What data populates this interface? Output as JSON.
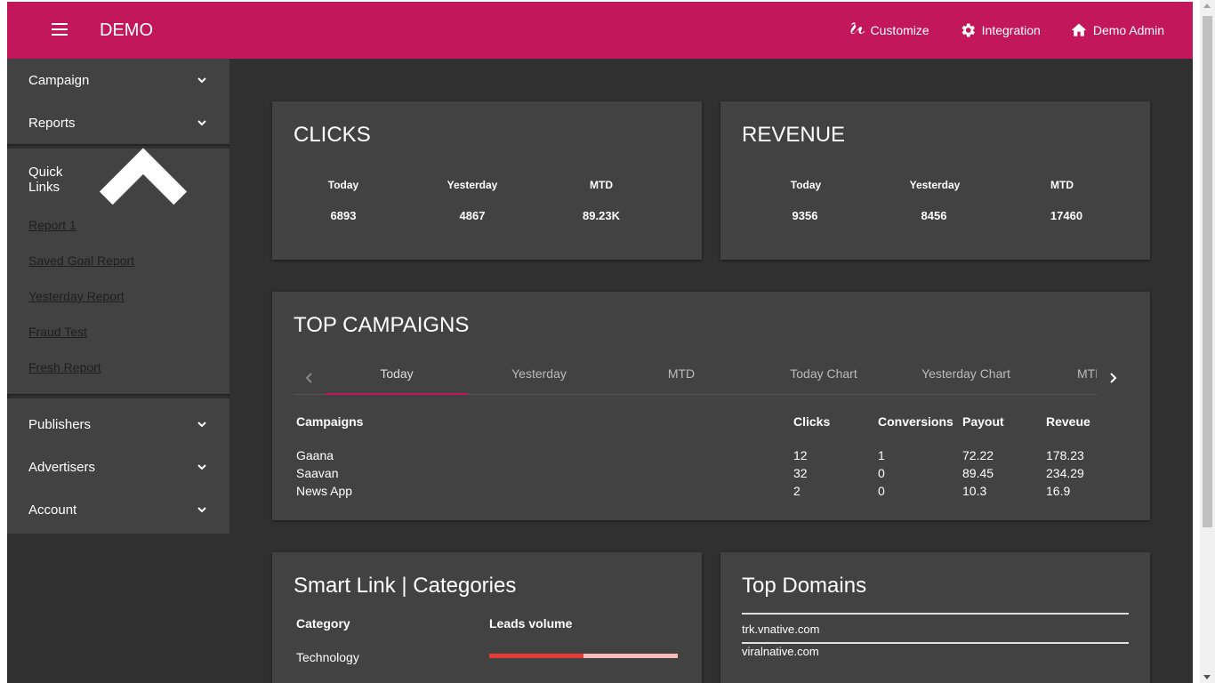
{
  "header": {
    "brand": "DEMO",
    "actions": [
      {
        "label": "Customize",
        "icon": "brush-icon"
      },
      {
        "label": "Integration",
        "icon": "gear-icon"
      },
      {
        "label": "Demo Admin",
        "icon": "home-icon"
      }
    ]
  },
  "sidebar": {
    "campaign": "Campaign",
    "reports": "Reports",
    "quick_links_title": "Quick Links",
    "quick_links": [
      "Report 1",
      "Saved Goal Report",
      "Yesterday Report",
      "Fraud Test",
      "Fresh Report"
    ],
    "publishers": "Publishers",
    "advertisers": "Advertisers",
    "account": "Account"
  },
  "clicks": {
    "title": "CLICKS",
    "labels": [
      "Today",
      "Yesterday",
      "MTD"
    ],
    "values": [
      "6893",
      "4867",
      "89.23K"
    ]
  },
  "revenue": {
    "title": "REVENUE",
    "labels": [
      "Today",
      "Yesterday",
      "MTD"
    ],
    "values": [
      "9356",
      "8456",
      "17460"
    ]
  },
  "top_campaigns": {
    "title": "TOP CAMPAIGNS",
    "tabs": [
      "Today",
      "Yesterday",
      "MTD",
      "Today Chart",
      "Yesterday Chart",
      "MTD Chart"
    ],
    "active_tab": "Today",
    "columns": [
      "Campaigns",
      "Clicks",
      "Conversions",
      "Payout",
      "Reveue"
    ],
    "rows": [
      [
        "Gaana",
        "12",
        "1",
        "72.22",
        "178.23"
      ],
      [
        "Saavan",
        "32",
        "0",
        "89.45",
        "234.29"
      ],
      [
        "News App",
        "2",
        "0",
        "10.3",
        "16.9"
      ]
    ]
  },
  "smart_link": {
    "title": "Smart Link | Categories",
    "col_category": "Category",
    "col_leads": "Leads volume",
    "rows": [
      {
        "category": "Technology",
        "leads_fraction": 0.5
      }
    ]
  },
  "top_domains": {
    "title": "Top Domains",
    "domains": [
      "trk.vnative.com",
      "viralnative.com"
    ]
  },
  "colors": {
    "primary": "#c2185b",
    "background": "#303030",
    "card": "#424242",
    "bar_fill": "#e53935",
    "bar_track": "#f8bbbb"
  }
}
